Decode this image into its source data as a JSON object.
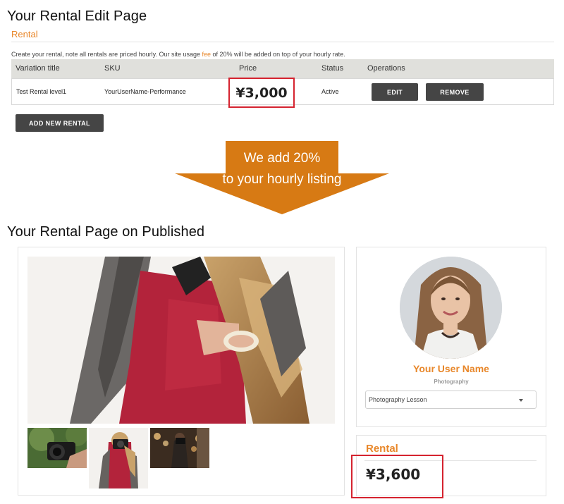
{
  "edit_section": {
    "heading": "Your Rental Edit Page",
    "rental_label": "Rental",
    "note_before": "Create your rental, note all rentals are priced hourly. Our site usage ",
    "note_link": "fee",
    "note_after": " of 20% will be added on top of your hourly rate.",
    "columns": [
      "Variation title",
      "SKU",
      "Price",
      "Status",
      "Operations"
    ],
    "row": {
      "title": "Test Rental level1",
      "sku": "YourUserName-Performance",
      "price": "¥3,000",
      "status": "Active",
      "edit_label": "EDIT",
      "remove_label": "REMOVE"
    },
    "add_button": "ADD NEW RENTAL"
  },
  "arrow": {
    "line1": "We add 20%",
    "line2": "to your hourly listing"
  },
  "published_section": {
    "heading": "Your Rental Page on Published",
    "user_name": "Your User Name",
    "user_category": "Photography",
    "select_value": "Photography Lesson",
    "rental_label": "Rental",
    "price": "¥3,600"
  },
  "colors": {
    "accent": "#e8872a",
    "arrow": "#d77a14",
    "highlight_box": "#d5232f",
    "dark_button": "#454545"
  }
}
